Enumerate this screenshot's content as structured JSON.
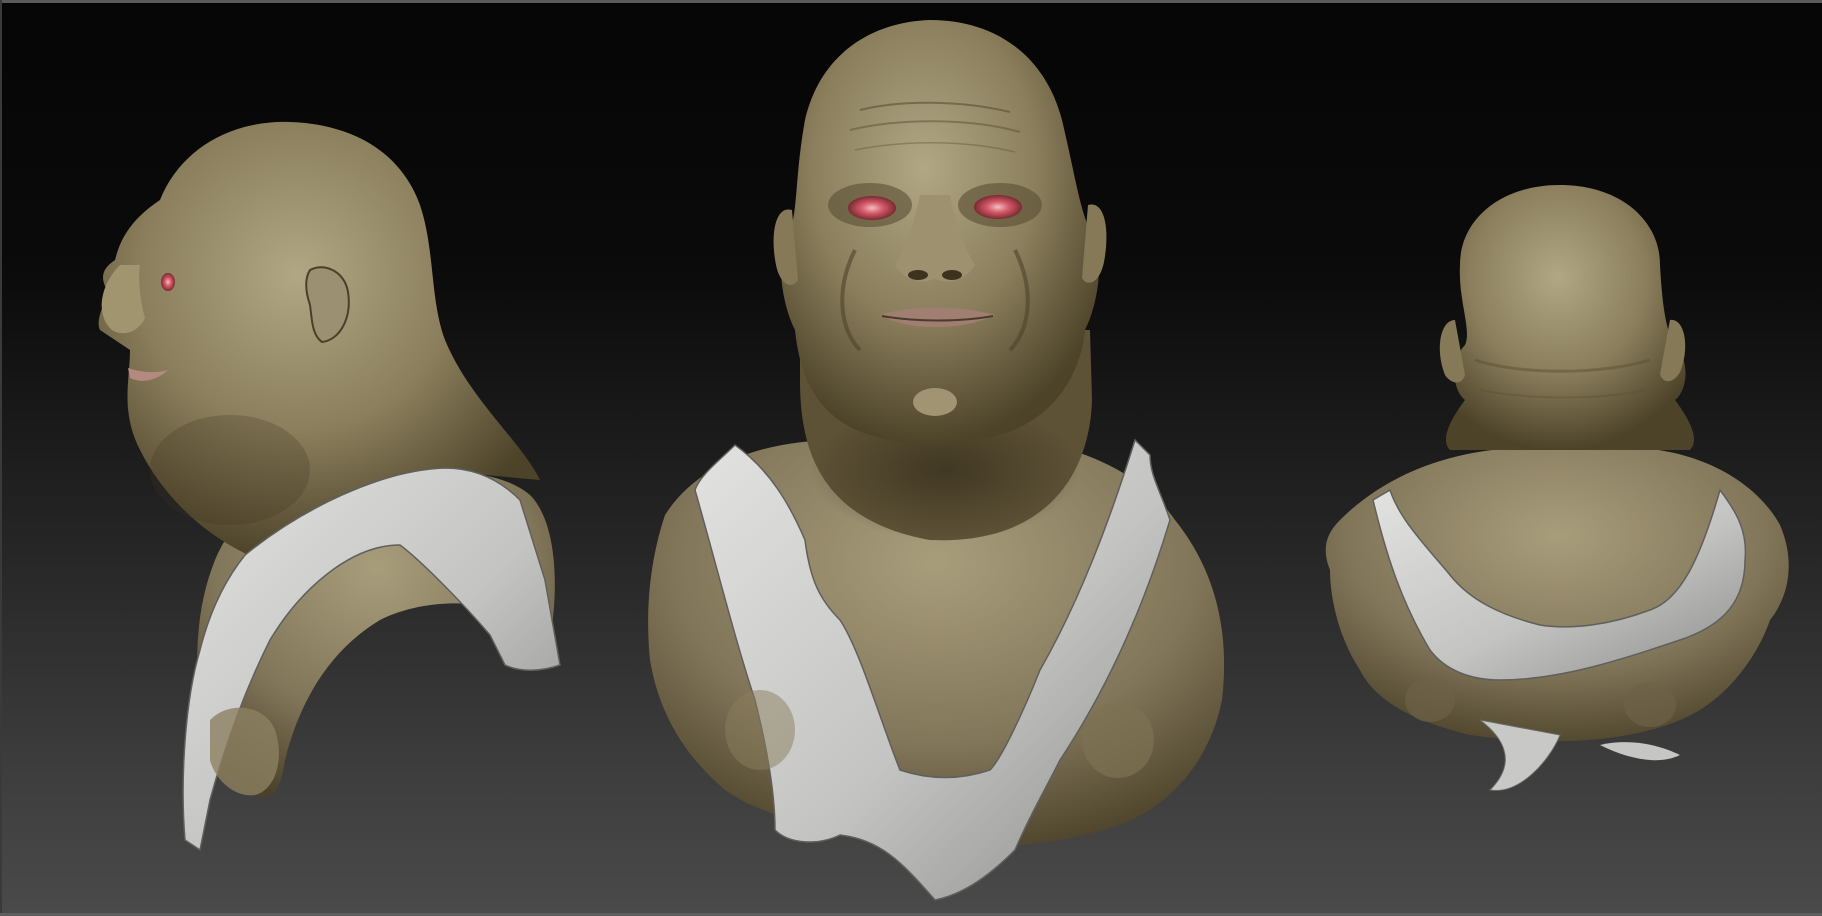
{
  "scene": {
    "views": [
      {
        "name": "side-view"
      },
      {
        "name": "front-view"
      },
      {
        "name": "back-view"
      }
    ]
  },
  "colors": {
    "skin": "#8e8262",
    "skin_shadow": "#54492f",
    "skin_highlight": "#b0a684",
    "shirt": "#c8c8c6",
    "shirt_shadow": "#8f8f8f",
    "eye": "#c94a5a",
    "background_top": "#050505",
    "background_bottom": "#4a4a4a"
  }
}
